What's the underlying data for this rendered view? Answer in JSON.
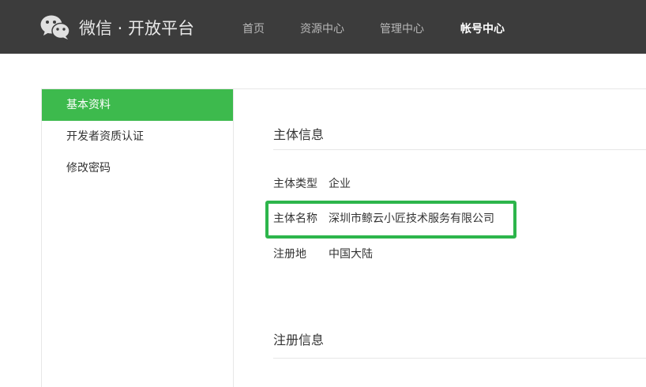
{
  "header": {
    "logo_text": "微信 · 开放平台",
    "nav": [
      "首页",
      "资源中心",
      "管理中心",
      "帐号中心"
    ],
    "active_nav": "帐号中心"
  },
  "sidebar": {
    "items": [
      "基本资料",
      "开发者资质认证",
      "修改密码"
    ],
    "active_item": "基本资料"
  },
  "main": {
    "subject_info": {
      "title": "主体信息",
      "rows": [
        {
          "label": "主体类型",
          "value": "企业"
        },
        {
          "label": "主体名称",
          "value": "深圳市鲸云小匠技术服务有限公司"
        },
        {
          "label": "注册地",
          "value": "中国大陆"
        }
      ]
    },
    "registration_info": {
      "title": "注册信息"
    }
  },
  "colors": {
    "topbar": "#3c3c3c",
    "accent_green": "#3dba4d",
    "highlight_green": "#2db54b"
  }
}
